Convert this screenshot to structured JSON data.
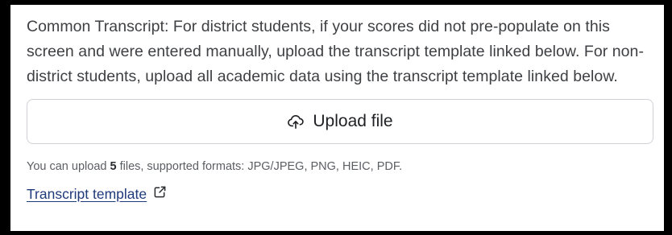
{
  "field": {
    "description": "Common Transcript: For district students, if your scores did not pre-populate on this screen and were entered manually, upload the transcript template linked below. For non-district students, upload all academic data using the transcript template linked below."
  },
  "upload": {
    "icon": "cloud-upload-icon",
    "label": "Upload file"
  },
  "hint": {
    "prefix": "You can upload ",
    "max_files": "5",
    "suffix": " files, supported formats: JPG/JPEG, PNG, HEIC, PDF."
  },
  "template_link": {
    "label": "Transcript template",
    "icon": "external-link-icon"
  },
  "colors": {
    "text": "#3f4043",
    "link": "#1f3a7a",
    "border": "#cfd2d6",
    "frame": "#000000"
  }
}
